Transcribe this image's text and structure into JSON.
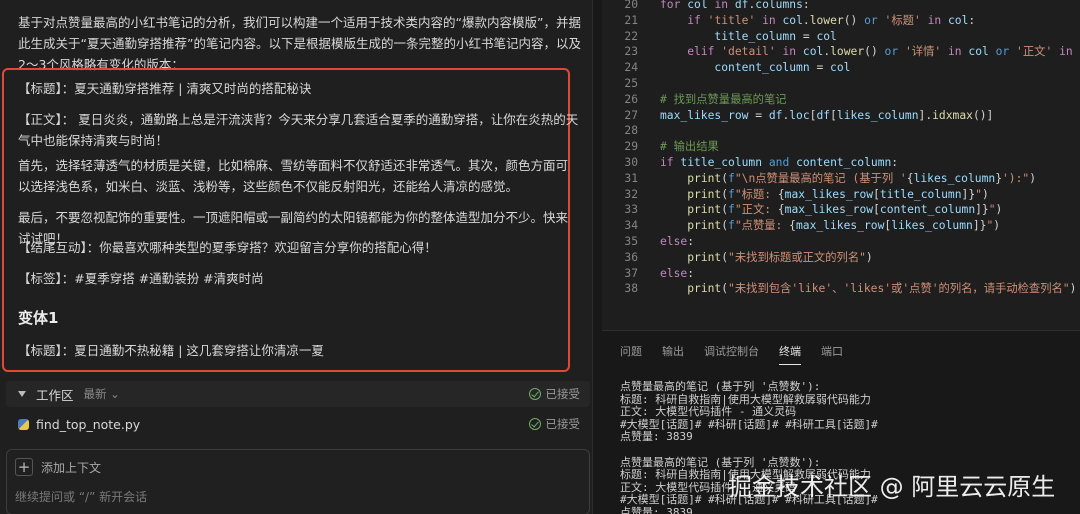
{
  "chat": {
    "intro": "基于对点赞量最高的小红书笔记的分析，我们可以构建一个适用于技术类内容的“爆款内容模版”，并据此生成关于“夏天通勤穿搭推荐”的笔记内容。以下是根据模版生成的一条完整的小红书笔记内容，以及2～3个风格略有变化的版本：",
    "title_line": "【标题】：夏天通勤穿搭推荐 | 清爽又时尚的搭配秘诀",
    "body_line": "【正文】： 夏日炎炎，通勤路上总是汗流浃背？今天来分享几套适合夏季的通勤穿搭，让你在炎热的天气中也能保持清爽与时尚！",
    "para1": "首先，选择轻薄透气的材质是关键，比如棉麻、雪纺等面料不仅舒适还非常透气。其次，颜色方面可以选择浅色系，如米白、淡蓝、浅粉等，这些颜色不仅能反射阳光，还能给人清凉的感觉。",
    "para2": "最后，不要忽视配饰的重要性。一顶遮阳帽或一副简约的太阳镜都能为你的整体造型加分不少。快来试试吧！",
    "ending": "【结尾互动】：你最喜欢哪种类型的夏季穿搭？欢迎留言分享你的搭配心得！",
    "tags": "【标签】：#夏季穿搭 #通勤装扮 #清爽时尚",
    "variant_heading": "变体1",
    "variant_title": "【标题】：夏日通勤不热秘籍 | 这几套穿搭让你清凉一夏"
  },
  "workspace": {
    "label": "工作区",
    "sub": "最新",
    "status": "已接受"
  },
  "file": {
    "name": "find_top_note.py",
    "status": "已接受"
  },
  "composer": {
    "add_context": "添加上下文",
    "placeholder": "继续提问或 “/” 新开会话"
  },
  "editor": {
    "lines": [
      {
        "n": "20",
        "html": "<span class=\"kw\">for</span> <span class=\"v\">col</span> <span class=\"kw\">in</span> <span class=\"v\">df</span>.<span class=\"v\">columns</span>:"
      },
      {
        "n": "21",
        "html": "    <span class=\"kw\">if</span> <span class=\"s\">'title'</span> <span class=\"kw\">in</span> <span class=\"v\">col</span>.<span class=\"fn\">lower</span>() <span class=\"k2\">or</span> <span class=\"s\">'标题'</span> <span class=\"kw\">in</span> <span class=\"v\">col</span>:"
      },
      {
        "n": "22",
        "html": "        <span class=\"v\">title_column</span> = <span class=\"v\">col</span>"
      },
      {
        "n": "23",
        "html": "    <span class=\"kw\">elif</span> <span class=\"s\">'detail'</span> <span class=\"kw\">in</span> <span class=\"v\">col</span>.<span class=\"fn\">lower</span>() <span class=\"k2\">or</span> <span class=\"s\">'详情'</span> <span class=\"kw\">in</span> <span class=\"v\">col</span> <span class=\"k2\">or</span> <span class=\"s\">'正文'</span> <span class=\"kw\">in</span> <span class=\"v\">col</span>:"
      },
      {
        "n": "24",
        "html": "        <span class=\"v\">content_column</span> = <span class=\"v\">col</span>"
      },
      {
        "n": "25",
        "html": ""
      },
      {
        "n": "26",
        "html": "<span class=\"c\"># 找到点赞量最高的笔记</span>"
      },
      {
        "n": "27",
        "html": "<span class=\"v\">max_likes_row</span> = <span class=\"v\">df</span>.<span class=\"v\">loc</span>[<span class=\"v\">df</span>[<span class=\"v\">likes_column</span>].<span class=\"fn\">idxmax</span>()]"
      },
      {
        "n": "28",
        "html": ""
      },
      {
        "n": "29",
        "html": "<span class=\"c\"># 输出结果</span>"
      },
      {
        "n": "30",
        "html": "<span class=\"kw\">if</span> <span class=\"v\">title_column</span> <span class=\"k2\">and</span> <span class=\"v\">content_column</span>:"
      },
      {
        "n": "31",
        "html": "    <span class=\"fn\">print</span>(<span class=\"k2\">f</span><span class=\"s\">\"\\n点赞量最高的笔记 (基于列 '</span>{<span class=\"v\">likes_column</span>}<span class=\"s\">'):\"</span>)"
      },
      {
        "n": "32",
        "html": "    <span class=\"fn\">print</span>(<span class=\"k2\">f</span><span class=\"s\">\"标题: </span>{<span class=\"v\">max_likes_row</span>[<span class=\"v\">title_column</span>]}<span class=\"s\">\"</span>)"
      },
      {
        "n": "33",
        "html": "    <span class=\"fn\">print</span>(<span class=\"k2\">f</span><span class=\"s\">\"正文: </span>{<span class=\"v\">max_likes_row</span>[<span class=\"v\">content_column</span>]}<span class=\"s\">\"</span>)"
      },
      {
        "n": "34",
        "html": "    <span class=\"fn\">print</span>(<span class=\"k2\">f</span><span class=\"s\">\"点赞量: </span>{<span class=\"v\">max_likes_row</span>[<span class=\"v\">likes_column</span>]}<span class=\"s\">\"</span>)"
      },
      {
        "n": "35",
        "html": "<span class=\"kw\">else</span>:"
      },
      {
        "n": "36",
        "html": "    <span class=\"fn\">print</span>(<span class=\"s\">\"未找到标题或正文的列名\"</span>)"
      },
      {
        "n": "37",
        "html": "<span class=\"kw\">else</span>:"
      },
      {
        "n": "38",
        "html": "    <span class=\"fn\">print</span>(<span class=\"s\">\"未找到包含'like'、'likes'或'点赞'的列名，请手动检查列名\"</span>)"
      }
    ]
  },
  "panel": {
    "tabs": [
      "问题",
      "输出",
      "调试控制台",
      "终端",
      "端口"
    ],
    "active_tab": "终端",
    "terminal": "点赞量最高的笔记 (基于列 '点赞数'):\n标题: 科研自救指南|使用大模型解救孱弱代码能力\n正文: 大模型代码插件 - 通义灵码\n#大模型[话题]# #科研[话题]# #科研工具[话题]#\n点赞量: 3839\n\n点赞量最高的笔记 (基于列 '点赞数'):\n标题: 科研自救指南|使用大模型解救孱弱代码能力\n正文: 大模型代码插件 - 通义灵码\n#大模型[话题]# #科研[话题]# #科研工具[话题]#\n点赞量: 3839"
  },
  "watermark": "掘金技术社区 @ 阿里云云原生"
}
